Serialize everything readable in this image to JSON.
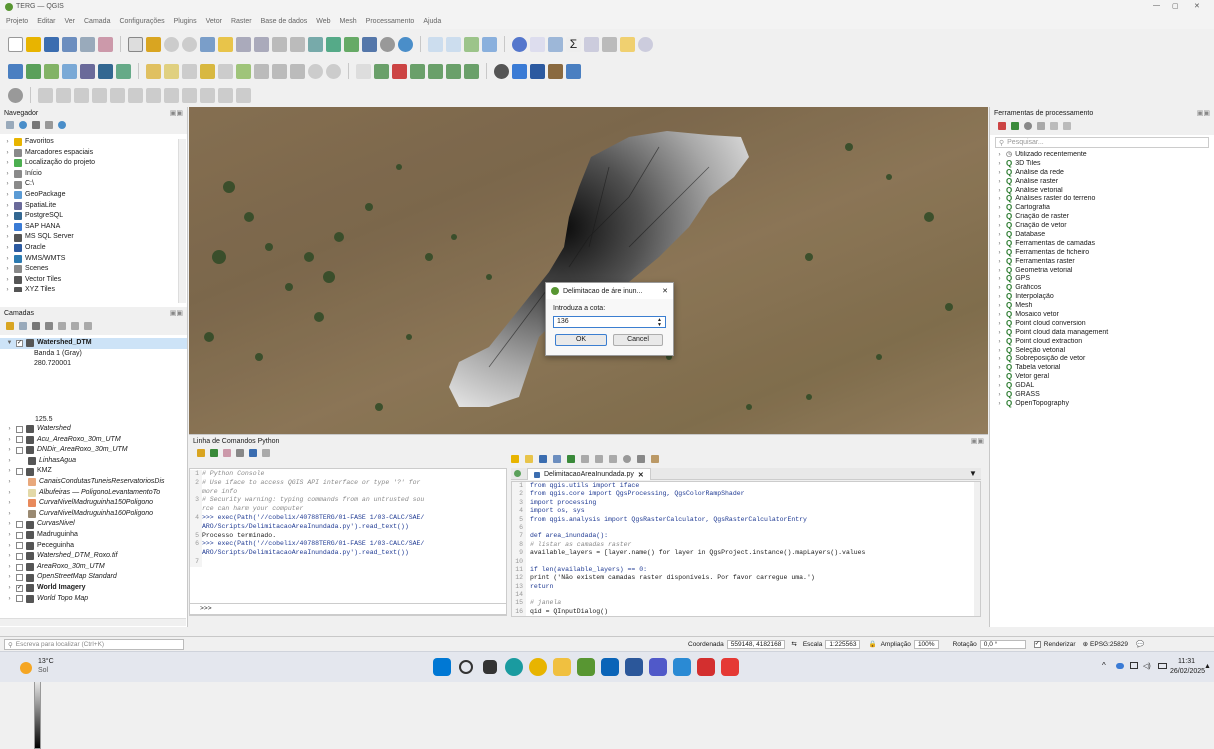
{
  "window": {
    "title": "TERG — QGIS",
    "controls": [
      "—",
      "▢",
      "✕"
    ]
  },
  "menubar": [
    "Projeto",
    "Editar",
    "Ver",
    "Camada",
    "Configurações",
    "Plugins",
    "Vetor",
    "Raster",
    "Base de dados",
    "Web",
    "Mesh",
    "Processamento",
    "Ajuda"
  ],
  "browser": {
    "title": "Navegador",
    "items": [
      {
        "label": "Favoritos",
        "icon": "star-icon",
        "color": "#e8b400"
      },
      {
        "label": "Marcadores espaciais",
        "icon": "bookmark-icon",
        "color": "#8a8a8a"
      },
      {
        "label": "Localização do projeto",
        "icon": "project-folder-icon",
        "color": "#4caf50"
      },
      {
        "label": "Início",
        "icon": "home-folder-icon",
        "color": "#8a8a8a"
      },
      {
        "label": "C:\\",
        "icon": "drive-icon",
        "color": "#8a8a8a"
      },
      {
        "label": "GeoPackage",
        "icon": "geopackage-icon",
        "color": "#5b9bd5"
      },
      {
        "label": "SpatiaLite",
        "icon": "spatialite-icon",
        "color": "#6a6a9a"
      },
      {
        "label": "PostgreSQL",
        "icon": "postgresql-icon",
        "color": "#336791"
      },
      {
        "label": "SAP HANA",
        "icon": "sap-hana-icon",
        "color": "#3a7bd5"
      },
      {
        "label": "MS SQL Server",
        "icon": "mssql-icon",
        "color": "#555"
      },
      {
        "label": "Oracle",
        "icon": "oracle-icon",
        "color": "#2c5aa0"
      },
      {
        "label": "WMS/WMTS",
        "icon": "wms-icon",
        "color": "#2c7ab0"
      },
      {
        "label": "Scenes",
        "icon": "scenes-icon",
        "color": "#888"
      },
      {
        "label": "Vector Tiles",
        "icon": "vector-tiles-icon",
        "color": "#555"
      },
      {
        "label": "XYZ Tiles",
        "icon": "xyz-tiles-icon",
        "color": "#555"
      }
    ]
  },
  "layers": {
    "title": "Camadas",
    "active_layer": "Watershed_DTM",
    "band": "Banda 1 (Gray)",
    "max": "280.720001",
    "min": "125.5",
    "items": [
      {
        "label": "Watershed",
        "checked": false,
        "italic": true,
        "icon": "vector-icon",
        "color": "#555"
      },
      {
        "label": "Acu_AreaRoxo_30m_UTM",
        "checked": false,
        "italic": true,
        "icon": "raster-icon",
        "color": "#555"
      },
      {
        "label": "DNDir_AreaRoxo_30m_UTM",
        "checked": false,
        "italic": true,
        "icon": "raster-icon",
        "color": "#555"
      },
      {
        "label": "LinhasAgua",
        "checked": null,
        "italic": true,
        "icon": "line-icon",
        "color": "#555"
      },
      {
        "label": "KMZ",
        "checked": false,
        "italic": false,
        "icon": "group-icon",
        "color": "#555"
      },
      {
        "label": "CanaisCondutasTuneisReservatoriosDis",
        "checked": null,
        "italic": true,
        "icon": "polygon-icon",
        "color": "#e8a87c"
      },
      {
        "label": "Albufeiras — PoligonoLevantamentoTo",
        "checked": null,
        "italic": true,
        "icon": "polygon-icon",
        "color": "#e3d9a8"
      },
      {
        "label": "CurvaNivelMadruguinha150Poligono",
        "checked": null,
        "italic": true,
        "icon": "polygon-icon",
        "color": "#e88a5c"
      },
      {
        "label": "CurvaNivelMadruguinha160Poligono",
        "checked": null,
        "italic": true,
        "icon": "polygon-icon",
        "color": "#9a8a72"
      },
      {
        "label": "CurvasNivel",
        "checked": false,
        "italic": true,
        "icon": "line-icon",
        "color": "#555"
      },
      {
        "label": "Madruguinha",
        "checked": false,
        "italic": false,
        "icon": "group-icon",
        "color": "#555"
      },
      {
        "label": "Peceguinha",
        "checked": false,
        "italic": false,
        "icon": "group-icon",
        "color": "#555"
      },
      {
        "label": "Watershed_DTM_Roxo.tif",
        "checked": false,
        "italic": true,
        "icon": "raster-icon",
        "color": "#555"
      },
      {
        "label": "AreaRoxo_30m_UTM",
        "checked": false,
        "italic": true,
        "icon": "raster-icon",
        "color": "#555"
      },
      {
        "label": "OpenStreetMap Standard",
        "checked": false,
        "italic": true,
        "icon": "xyz-icon",
        "color": "#555"
      },
      {
        "label": "World Imagery",
        "checked": true,
        "italic": false,
        "bold": true,
        "icon": "xyz-icon",
        "color": "#555"
      },
      {
        "label": "World Topo Map",
        "checked": false,
        "italic": true,
        "icon": "xyz-icon",
        "color": "#555"
      }
    ]
  },
  "console": {
    "title": "Linha de Comandos Python",
    "lines": [
      {
        "n": "1",
        "t": "# Python Console",
        "c": "#8a8a8a",
        "i": true
      },
      {
        "n": "2",
        "t": "# Use iface to access QGIS API interface or type '?' for",
        "c": "#8a8a8a",
        "i": true
      },
      {
        "n": "",
        "t": "more info",
        "c": "#8a8a8a",
        "i": true
      },
      {
        "n": "3",
        "t": "# Security warning: typing commands from an untrusted sou",
        "c": "#8a8a8a",
        "i": true
      },
      {
        "n": "",
        "t": "rce can harm your computer",
        "c": "#8a8a8a",
        "i": true
      },
      {
        "n": "4",
        "t": ">>> exec(Path('//cobelix/40788TERG/01-FASE 1/03-CALC/SAE/",
        "c": "#1f3a93",
        "i": false
      },
      {
        "n": "",
        "t": "ARO/Scripts/DelimitacaoAreaInundada.py').read_text())",
        "c": "#1f3a93",
        "i": false
      },
      {
        "n": "5",
        "t": "Processo terminado.",
        "c": "#1a1a1a",
        "i": false
      },
      {
        "n": "6",
        "t": ">>> exec(Path('//cobelix/40788TERG/01-FASE 1/03-CALC/SAE/",
        "c": "#1f3a93",
        "i": false
      },
      {
        "n": "",
        "t": "ARO/Scripts/DelimitacaoAreaInundada.py').read_text())",
        "c": "#1f3a93",
        "i": false
      },
      {
        "n": "7",
        "t": "",
        "c": "#1a1a1a",
        "i": false
      }
    ],
    "prompt": ">>>"
  },
  "editor": {
    "tab": "DelimitacaoAreaInundada.py",
    "lines": [
      {
        "n": "1",
        "t": "from qgis.utils import iface",
        "c": "#1f3a93",
        "i": false
      },
      {
        "n": "2",
        "t": "from qgis.core import QgsProcessing, QgsColorRampShader",
        "c": "#1f3a93",
        "i": false
      },
      {
        "n": "3",
        "t": "import processing",
        "c": "#1f3a93",
        "i": false
      },
      {
        "n": "4",
        "t": "import os, sys",
        "c": "#1f3a93",
        "i": false
      },
      {
        "n": "5",
        "t": "from qgis.analysis import QgsRasterCalculator, QgsRasterCalculatorEntry",
        "c": "#1f3a93",
        "i": false
      },
      {
        "n": "6",
        "t": "",
        "c": "#1a1a1a",
        "i": false
      },
      {
        "n": "7",
        "t": "def area_inundada():",
        "c": "#1f3a93",
        "i": false
      },
      {
        "n": "8",
        "t": "    # listar as camadas raster",
        "c": "#8a8a8a",
        "i": true
      },
      {
        "n": "9",
        "t": "    available_layers = [layer.name() for layer in QgsProject.instance().mapLayers().values",
        "c": "#1a1a1a",
        "i": false
      },
      {
        "n": "10",
        "t": "",
        "c": "#1a1a1a",
        "i": false
      },
      {
        "n": "11",
        "t": "    if len(available_layers) == 0:",
        "c": "#1f3a93",
        "i": false
      },
      {
        "n": "12",
        "t": "        print ('Não existem camadas raster disponíveis. Por favor carregue uma.')",
        "c": "#1a1a1a",
        "i": false
      },
      {
        "n": "13",
        "t": "        return",
        "c": "#1f3a93",
        "i": false
      },
      {
        "n": "14",
        "t": "",
        "c": "#1a1a1a",
        "i": false
      },
      {
        "n": "15",
        "t": "    # janela",
        "c": "#8a8a8a",
        "i": true
      },
      {
        "n": "16",
        "t": "    qid = QInputDialog()",
        "c": "#1a1a1a",
        "i": false
      }
    ]
  },
  "dialog": {
    "title": "Delimitacao de áre inun...",
    "label": "Introduza a cota:",
    "value": "136",
    "ok": "OK",
    "cancel": "Cancel"
  },
  "processing": {
    "title": "Ferramentas de processamento",
    "search_placeholder": "Pesquisar...",
    "items": [
      "Utilizado recentemente",
      "3D Tiles",
      "Análise da rede",
      "Análise raster",
      "Análise vetorial",
      "Análises raster do terreno",
      "Cartografia",
      "Criação de raster",
      "Criação de vetor",
      "Database",
      "Ferramentas de camadas",
      "Ferramentas de ficheiro",
      "Ferramentas raster",
      "Geometria vetorial",
      "GPS",
      "Gráficos",
      "Interpolação",
      "Mesh",
      "Mosaico vetor",
      "Point cloud conversion",
      "Point cloud data management",
      "Point cloud extraction",
      "Seleção vetorial",
      "Sobreposição de vetor",
      "Tabela vetorial",
      "Vetor geral",
      "GDAL",
      "GRASS",
      "OpenTopography"
    ]
  },
  "statusbar": {
    "locator_placeholder": "Escreva para localizar (Ctrl+K)",
    "coord_label": "Coordenada",
    "coord_value": "559148, 4182168",
    "scale_label": "Escala",
    "scale_value": "1:225563",
    "zoom_label": "Ampliação",
    "zoom_value": "100%",
    "rotation_label": "Rotação",
    "rotation_value": "0,0 °",
    "render_label": "Renderizar",
    "crs": "EPSG:25829"
  },
  "taskbar": {
    "temp": "13°C",
    "weather": "Sol",
    "time": "11:31",
    "date": "26/02/2025"
  }
}
